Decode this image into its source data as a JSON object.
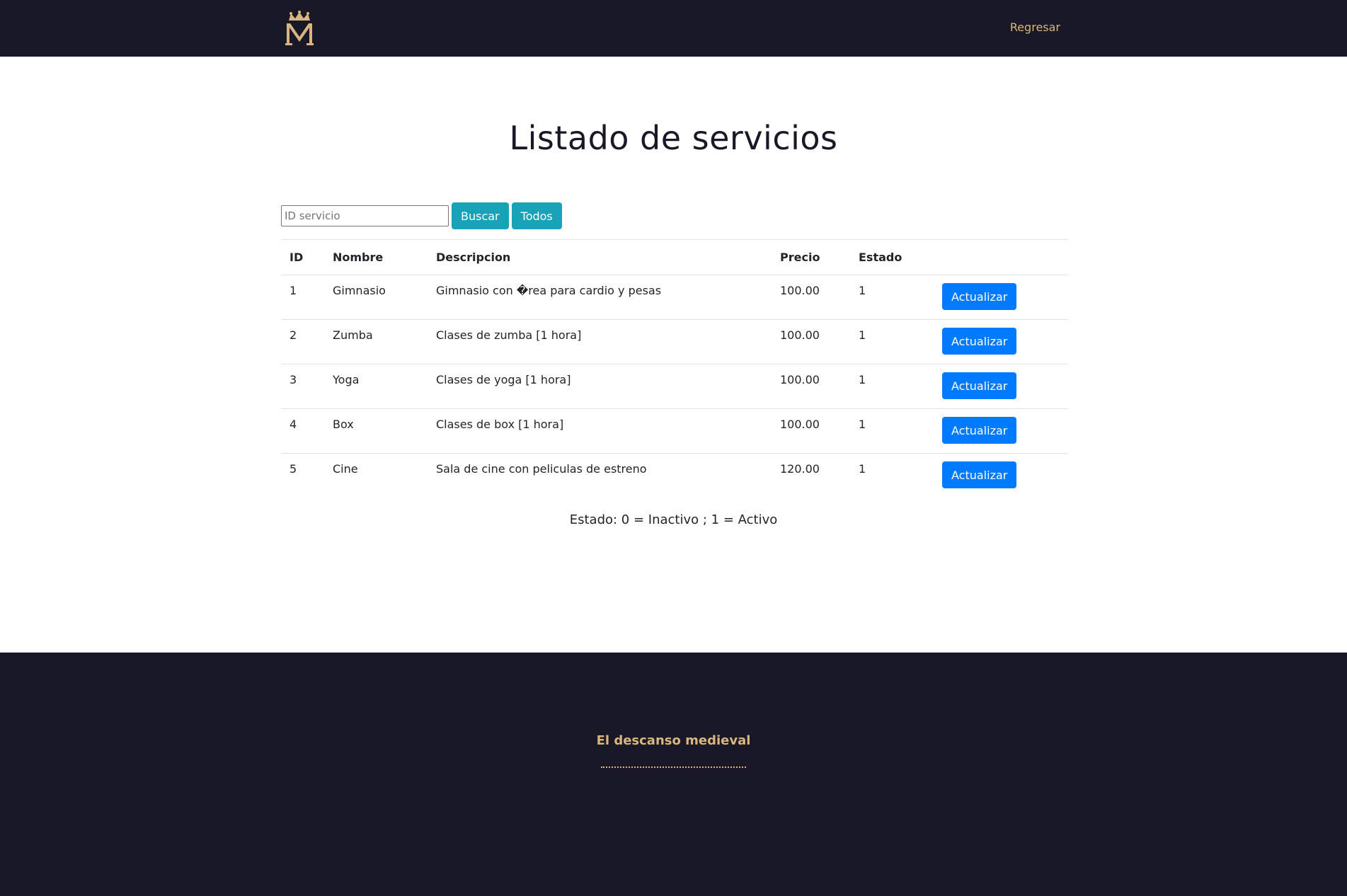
{
  "header": {
    "logo_alt": "M",
    "nav_link": "Regresar"
  },
  "main": {
    "title": "Listado de servicios",
    "search": {
      "placeholder": "ID servicio",
      "value": "",
      "search_button": "Buscar",
      "all_button": "Todos"
    },
    "table": {
      "columns": [
        "ID",
        "Nombre",
        "Descripcion",
        "Precio",
        "Estado",
        ""
      ],
      "rows": [
        {
          "id": "1",
          "nombre": "Gimnasio",
          "descripcion": "Gimnasio con �rea para cardio y pesas",
          "precio": "100.00",
          "estado": "1",
          "action": "Actualizar"
        },
        {
          "id": "2",
          "nombre": "Zumba",
          "descripcion": "Clases de zumba [1 hora]",
          "precio": "100.00",
          "estado": "1",
          "action": "Actualizar"
        },
        {
          "id": "3",
          "nombre": "Yoga",
          "descripcion": "Clases de yoga [1 hora]",
          "precio": "100.00",
          "estado": "1",
          "action": "Actualizar"
        },
        {
          "id": "4",
          "nombre": "Box",
          "descripcion": "Clases de box [1 hora]",
          "precio": "100.00",
          "estado": "1",
          "action": "Actualizar"
        },
        {
          "id": "5",
          "nombre": "Cine",
          "descripcion": "Sala de cine con peliculas de estreno",
          "precio": "120.00",
          "estado": "1",
          "action": "Actualizar"
        }
      ]
    },
    "legend": "Estado: 0 = Inactivo ; 1 = Activo"
  },
  "footer": {
    "title": "El descanso medieval"
  },
  "colors": {
    "dark_bg": "#181826",
    "gold_accent": "#d9b57f",
    "info_button": "#17a2b8",
    "primary_button": "#007bff"
  },
  "icons": {
    "logo": "crown-m-logo-icon"
  }
}
